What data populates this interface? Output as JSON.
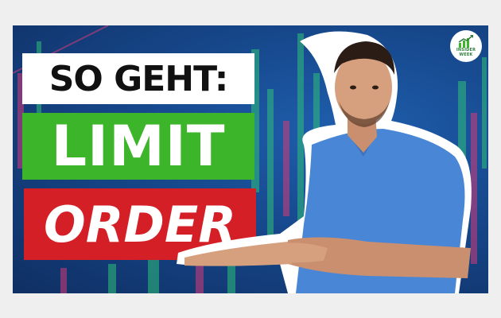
{
  "headline": {
    "line1": "SO GEHT:",
    "line2": "LIMIT",
    "line3": "ORDER"
  },
  "logo": {
    "line1": "INSIDER",
    "line2": "WEEK",
    "icon": "chart-growth-icon"
  },
  "colors": {
    "background": "#174a8f",
    "green": "#3db52a",
    "red": "#d41f26",
    "shirt": "#4a86d6"
  }
}
